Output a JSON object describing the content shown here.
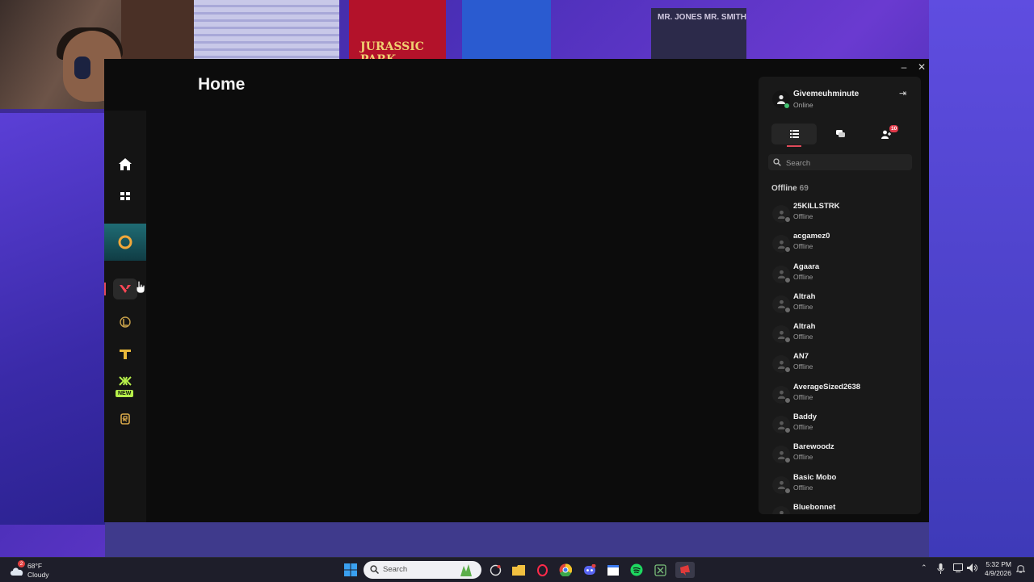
{
  "window": {
    "page_title": "Home",
    "minimize_label": "–",
    "close_label": "✕"
  },
  "sidebar": {
    "items": [
      {
        "name": "home",
        "icon": "home-icon"
      },
      {
        "name": "library",
        "icon": "grid-icon"
      },
      {
        "name": "riot-client-game",
        "icon": "ring-icon"
      },
      {
        "name": "valorant",
        "icon": "valorant-icon"
      },
      {
        "name": "league-of-legends",
        "icon": "league-icon"
      },
      {
        "name": "teamfight-tactics",
        "icon": "tft-icon"
      },
      {
        "name": "2xko",
        "icon": "2xko-icon",
        "badge": "NEW"
      },
      {
        "name": "legends-of-runeterra",
        "icon": "runeterra-icon"
      }
    ]
  },
  "friends": {
    "me": {
      "name": "Givemeuhminute",
      "status": "Online"
    },
    "tabs": [
      {
        "name": "friends-list",
        "icon": "list-icon"
      },
      {
        "name": "messages",
        "icon": "chat-icon"
      },
      {
        "name": "friend-requests",
        "icon": "add-friend-icon",
        "badge": "10"
      }
    ],
    "search_placeholder": "Search",
    "group": {
      "label": "Offline",
      "count": "69"
    },
    "list": [
      {
        "name": "25KILLSTRK",
        "status": "Offline"
      },
      {
        "name": "acgamez0",
        "status": "Offline"
      },
      {
        "name": "Agaara",
        "status": "Offline"
      },
      {
        "name": "Altrah",
        "status": "Offline"
      },
      {
        "name": "Altrah",
        "status": "Offline"
      },
      {
        "name": "AN7",
        "status": "Offline"
      },
      {
        "name": "AverageSized2638",
        "status": "Offline"
      },
      {
        "name": "Baddy",
        "status": "Offline"
      },
      {
        "name": "Barewoodz",
        "status": "Offline"
      },
      {
        "name": "Basic Mobo",
        "status": "Offline"
      },
      {
        "name": "Bluebonnet",
        "status": ""
      }
    ]
  },
  "taskbar": {
    "weather": {
      "temp": "68°F",
      "condition": "Cloudy",
      "badge": "2"
    },
    "search_placeholder": "Search",
    "clock": {
      "time": "5:32 PM",
      "date": "4/9/2026"
    }
  },
  "background": {
    "poster_text": "JURASSIC PARK",
    "poster2_text": "MR. JONES MR. SMITH"
  },
  "colors": {
    "accent": "#e04a5a",
    "online": "#42c070",
    "panel": "#191919",
    "window": "#0c0c0c"
  }
}
